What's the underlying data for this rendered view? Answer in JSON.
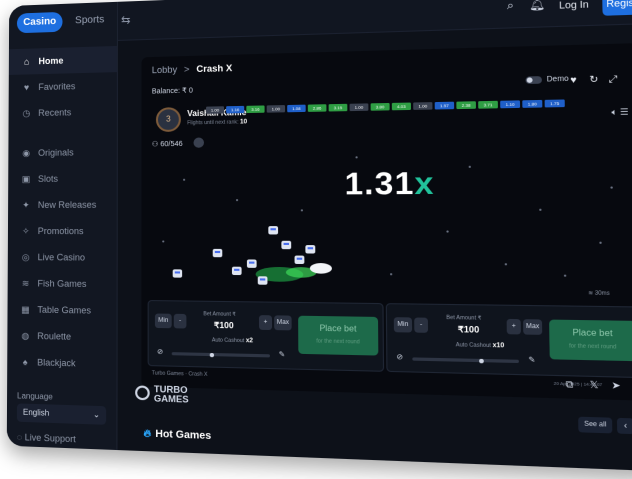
{
  "header": {
    "casino_tab": "Casino",
    "sports_tab": "Sports",
    "login": "Log In",
    "register": "Register"
  },
  "sidebar": {
    "items": [
      {
        "label": "Home",
        "icon": "home-icon",
        "active": true
      },
      {
        "label": "Favorites",
        "icon": "heart-icon"
      },
      {
        "label": "Recents",
        "icon": "clock-icon"
      },
      {
        "label": "Originals",
        "icon": "originals-icon"
      },
      {
        "label": "Slots",
        "icon": "slots-icon"
      },
      {
        "label": "New Releases",
        "icon": "new-icon"
      },
      {
        "label": "Promotions",
        "icon": "promo-icon"
      },
      {
        "label": "Live Casino",
        "icon": "live-icon"
      },
      {
        "label": "Fish Games",
        "icon": "fish-icon"
      },
      {
        "label": "Table Games",
        "icon": "table-icon"
      },
      {
        "label": "Roulette",
        "icon": "roulette-icon"
      },
      {
        "label": "Blackjack",
        "icon": "cards-icon"
      }
    ],
    "language_label": "Language",
    "language_value": "English",
    "live_support": "Live Support"
  },
  "game": {
    "breadcrumb_root": "Lobby",
    "breadcrumb_sep": ">",
    "breadcrumb_current": "Crash X",
    "balance": "Balance: ₹ 0",
    "demo_label": "Demo",
    "player_name": "Vaishali Kamle",
    "player_sub": "Flights until next rank:",
    "player_sub_value": "10",
    "rank_badge": "3",
    "players_count": "60/546",
    "multiplier_value": "1.31",
    "multiplier_suffix": "x",
    "history": [
      "1.00",
      "1.16",
      "3.16",
      "1.00",
      "1.08",
      "2.86",
      "3.15",
      "1.00",
      "3.80",
      "4.03",
      "1.00",
      "1.57",
      "2.38",
      "3.71",
      "1.10",
      "1.80",
      "1.75"
    ],
    "network": "30ms",
    "bet_panels": [
      {
        "min": "Min",
        "minus": "-",
        "plus": "+",
        "max": "Max",
        "amount_label": "Bet Amount ₹",
        "amount": "₹100",
        "cashout_label": "Auto Cashout",
        "cashout": "x2",
        "place": "Place bet",
        "place_sub": "for the next round"
      },
      {
        "min": "Min",
        "minus": "-",
        "plus": "+",
        "max": "Max",
        "amount_label": "Bet Amount ₹",
        "amount": "₹100",
        "cashout_label": "Auto Cashout",
        "cashout": "x10",
        "place": "Place bet",
        "place_sub": "for the next round"
      }
    ],
    "footer_left": "Turbo Games · Crash X",
    "footer_right": "20 Apr 2025 | 14:40:07",
    "provider_line1": "TURBO",
    "provider_line2": "GAMES"
  },
  "hot_games": {
    "title_prefix": "Hot",
    "title": "Games",
    "see_all": "See all"
  },
  "colors": {
    "accent": "#1e6fe0",
    "multiplier_x": "#21c29b",
    "place_bet": "#1d6a4a"
  }
}
